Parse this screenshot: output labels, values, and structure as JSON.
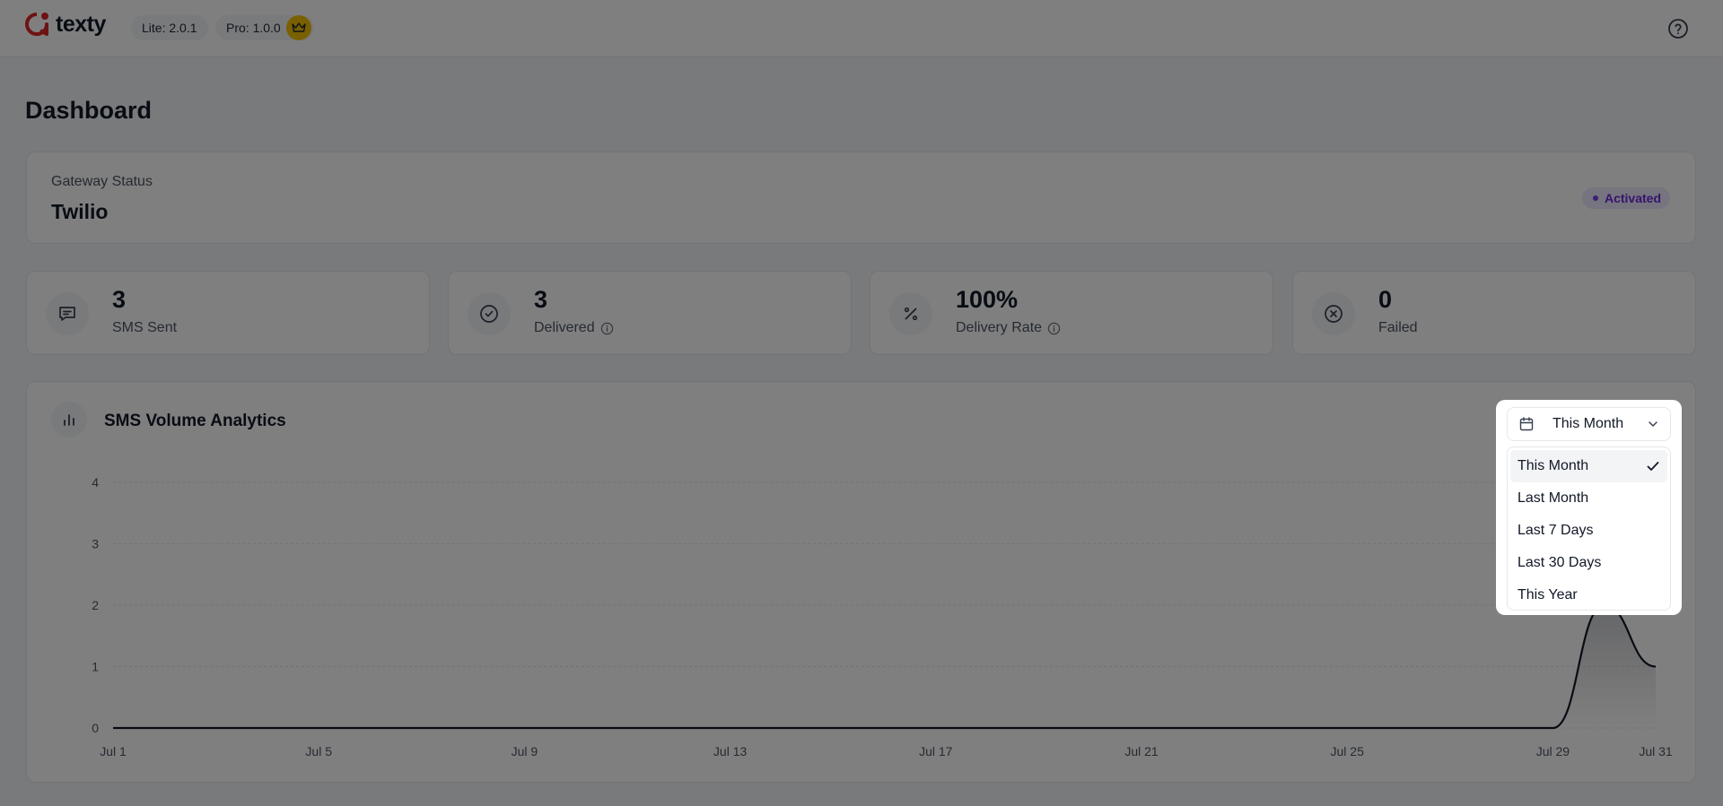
{
  "header": {
    "brand": "texty",
    "lite_version": "Lite: 2.0.1",
    "pro_version": "Pro: 1.0.0",
    "accent": "#dc2626",
    "pro_badge_color": "#f5c000",
    "help_icon": "help-circle-icon"
  },
  "page": {
    "title": "Dashboard"
  },
  "gateway": {
    "label": "Gateway Status",
    "name": "Twilio",
    "status": "Activated",
    "status_color": "#6d28d9"
  },
  "stats": [
    {
      "value": "3",
      "label": "SMS Sent",
      "icon": "message-icon"
    },
    {
      "value": "3",
      "label": "Delivered",
      "icon": "check-circle-icon",
      "has_info": true
    },
    {
      "value": "100%",
      "label": "Delivery Rate",
      "icon": "percent-icon",
      "has_info": true
    },
    {
      "value": "0",
      "label": "Failed",
      "icon": "x-circle-icon"
    }
  ],
  "analytics": {
    "title": "SMS Volume Analytics",
    "icon": "bar-chart-icon"
  },
  "date_filter": {
    "selected": "This Month",
    "options": [
      "This Month",
      "Last Month",
      "Last 7 Days",
      "Last 30 Days",
      "This Year"
    ]
  },
  "chart_data": {
    "type": "area",
    "title": "SMS Volume Analytics",
    "xlabel": "",
    "ylabel": "",
    "ylim": [
      0,
      4
    ],
    "y_ticks": [
      0,
      1,
      2,
      3,
      4
    ],
    "x_tick_labels": [
      "Jul 1",
      "Jul 5",
      "Jul 9",
      "Jul 13",
      "Jul 17",
      "Jul 21",
      "Jul 25",
      "Jul 29",
      "Jul 31"
    ],
    "x": [
      "Jul 1",
      "Jul 2",
      "Jul 3",
      "Jul 4",
      "Jul 5",
      "Jul 6",
      "Jul 7",
      "Jul 8",
      "Jul 9",
      "Jul 10",
      "Jul 11",
      "Jul 12",
      "Jul 13",
      "Jul 14",
      "Jul 15",
      "Jul 16",
      "Jul 17",
      "Jul 18",
      "Jul 19",
      "Jul 20",
      "Jul 21",
      "Jul 22",
      "Jul 23",
      "Jul 24",
      "Jul 25",
      "Jul 26",
      "Jul 27",
      "Jul 28",
      "Jul 29",
      "Jul 30",
      "Jul 31"
    ],
    "series": [
      {
        "values": [
          0,
          0,
          0,
          0,
          0,
          0,
          0,
          0,
          0,
          0,
          0,
          0,
          0,
          0,
          0,
          0,
          0,
          0,
          0,
          0,
          0,
          0,
          0,
          0,
          0,
          0,
          0,
          0,
          0,
          2,
          1
        ]
      }
    ],
    "grid": true,
    "line_color": "#111827"
  }
}
